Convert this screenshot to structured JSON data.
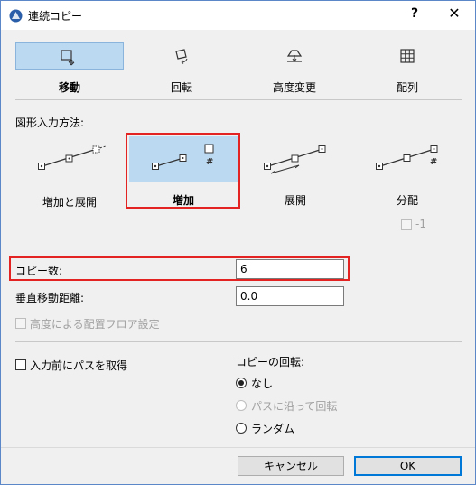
{
  "window": {
    "title": "連続コピー",
    "help_label": "?",
    "close_label": "✕"
  },
  "tools": [
    {
      "label": "移動",
      "icon": "move-icon",
      "active": true
    },
    {
      "label": "回転",
      "icon": "rotate-icon",
      "active": false
    },
    {
      "label": "高度変更",
      "icon": "elevate-icon",
      "active": false
    },
    {
      "label": "配列",
      "icon": "grid-icon",
      "active": false
    }
  ],
  "input_method": {
    "label": "図形入力方法:",
    "options": [
      {
        "label": "増加と展開",
        "active": false
      },
      {
        "label": "増加",
        "active": true,
        "symbol": "#"
      },
      {
        "label": "展開",
        "active": false
      },
      {
        "label": "分配",
        "active": false,
        "symbol": "#"
      }
    ],
    "minus_one_label": "-1"
  },
  "copies": {
    "label": "コピー数:",
    "value": "6"
  },
  "vertical_distance": {
    "label": "垂直移動距離:",
    "value": "0.0"
  },
  "floor_setting": {
    "label": "高度による配置フロア設定",
    "enabled": false,
    "checked": false
  },
  "path_before_input": {
    "label": "入力前にパスを取得",
    "checked": false
  },
  "rotation": {
    "label": "コピーの回転:",
    "options": [
      {
        "label": "なし",
        "selected": true,
        "enabled": true
      },
      {
        "label": "パスに沿って回転",
        "selected": false,
        "enabled": false
      },
      {
        "label": "ランダム",
        "selected": false,
        "enabled": true
      }
    ]
  },
  "buttons": {
    "cancel": "キャンセル",
    "ok": "OK"
  },
  "colors": {
    "accent": "#0078d7",
    "selected_bg": "#bcd9f2",
    "highlight": "#e32222"
  }
}
